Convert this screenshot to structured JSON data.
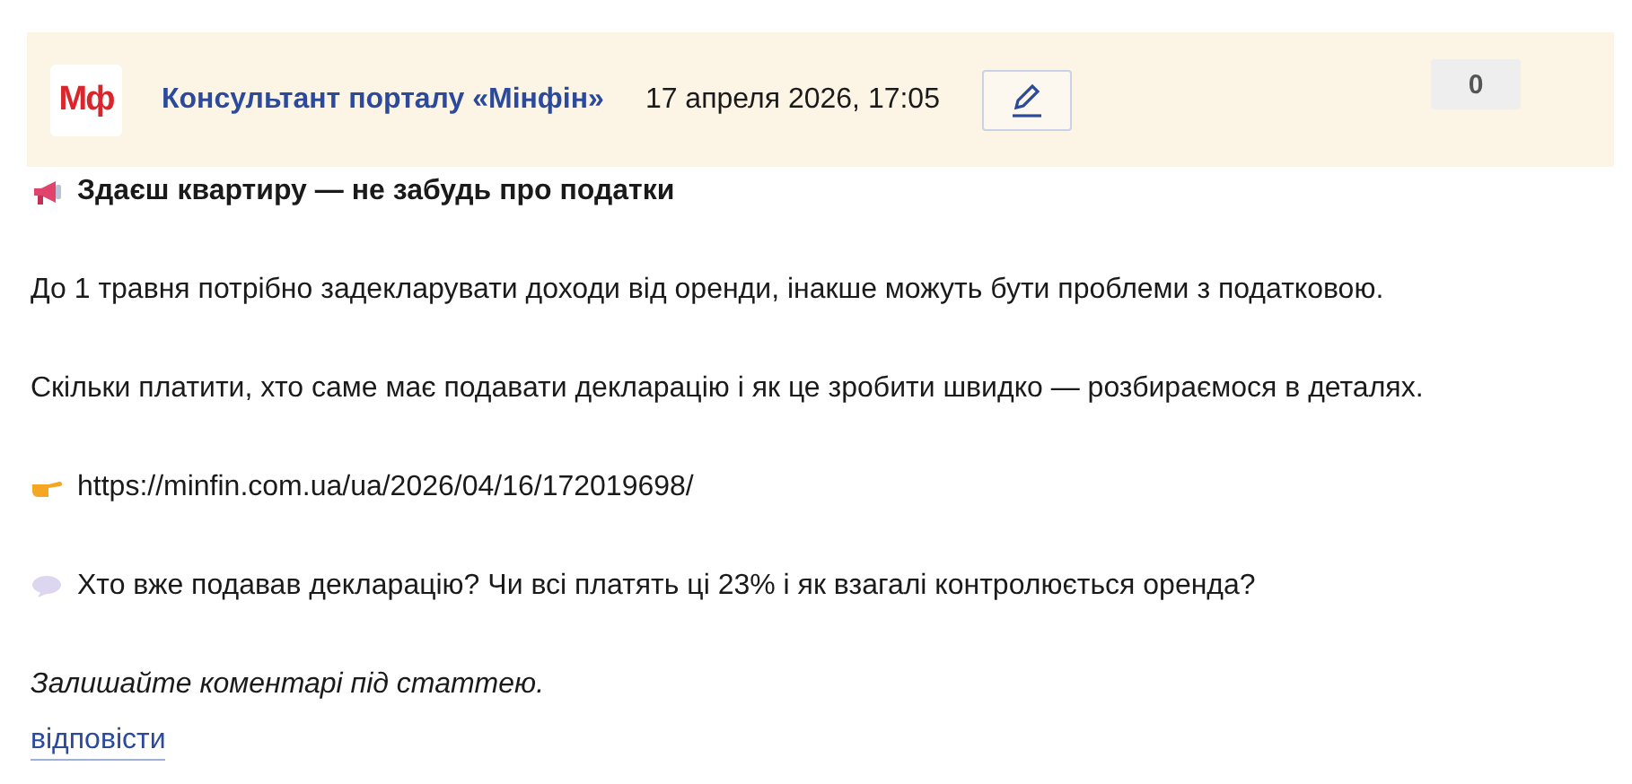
{
  "author": {
    "logo": "Мф",
    "name": "Консультант порталу «Мінфін»",
    "date": "17 апреля 2026, 17:05"
  },
  "counter": "0",
  "post": [
    {
      "kind": "title",
      "text": "Здаєш квартиру — не забудь про податки"
    },
    {
      "kind": "text",
      "text": "До 1 травня потрібно задекларувати доходи від оренди, інакше можуть бути проблеми з податковою."
    },
    {
      "kind": "text",
      "text": "Скільки платити, хто саме має подавати декларацію і як це зробити швидко — розбираємося в деталях."
    },
    {
      "kind": "link",
      "text": "https://minfin.com.ua/ua/2026/04/16/172019698/"
    },
    {
      "kind": "question",
      "text": "Хто вже подавав декларацію? Чи всі платять ці 23% і як взагалі контролюється оренда?"
    },
    {
      "kind": "italic",
      "text": "Залишайте коментарі під статтею."
    }
  ],
  "reply": "відповісти"
}
